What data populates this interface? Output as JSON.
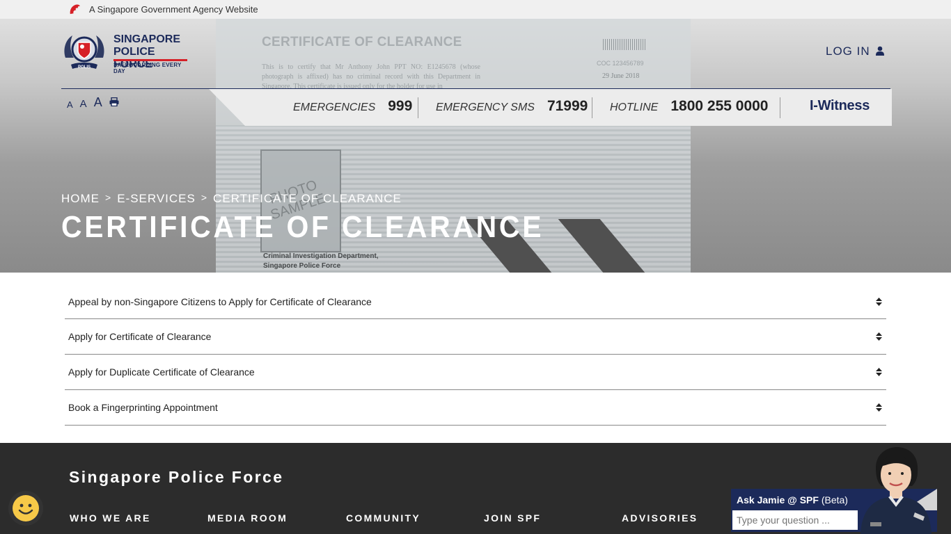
{
  "gov_bar": {
    "text": "A Singapore Government Agency Website"
  },
  "logo": {
    "title_line1": "SINGAPORE",
    "title_line2": "POLICE FORCE",
    "tagline": "SAFEGUARDING EVERY DAY",
    "badge_text": "POLIS"
  },
  "header": {
    "login_label": "LOG IN"
  },
  "hotlines": [
    {
      "label": "EMERGENCIES",
      "number": "999"
    },
    {
      "label": "EMERGENCY SMS",
      "number": "71999"
    },
    {
      "label": "HOTLINE",
      "number": "1800 255 0000"
    }
  ],
  "iwitness_label": "I-Witness",
  "font_tools": {
    "small": "A",
    "medium": "A",
    "large": "A"
  },
  "banner_image": {
    "heading": "CERTIFICATE OF CLEARANCE",
    "text": "This is to certify that Mr Anthony John PPT NO: E1245678 (whose photograph is affixed) has no criminal record with this Department in Singapore. This certificate is issued only for the holder for use in",
    "ref": "COC 123456789",
    "date": "29 June 2018",
    "photo_text_1": "PHOTO",
    "photo_text_2": "SAMPLE",
    "dept_line1": "Criminal Investigation Department,",
    "dept_line2": "Singapore Police Force"
  },
  "breadcrumb": {
    "home": "HOME",
    "sep1": ">",
    "eservices": "E-SERVICES",
    "sep2": ">",
    "current": "CERTIFICATE OF CLEARANCE"
  },
  "page_title": "CERTIFICATE OF CLEARANCE",
  "accordion": [
    {
      "label": "Appeal by non-Singapore Citizens to Apply for Certificate of Clearance"
    },
    {
      "label": "Apply for Certificate of Clearance"
    },
    {
      "label": "Apply for Duplicate Certificate of Clearance"
    },
    {
      "label": "Book a Fingerprinting Appointment"
    }
  ],
  "footer": {
    "title": "Singapore Police Force",
    "nav": [
      "WHO WE ARE",
      "MEDIA ROOM",
      "COMMUNITY",
      "JOIN SPF",
      "ADVISORIES"
    ]
  },
  "chat": {
    "title": "Ask Jamie @ SPF",
    "beta": "(Beta)",
    "placeholder": "Type your question ..."
  },
  "colors": {
    "navy": "#1c2a5a",
    "red": "#d62027",
    "footer_bg": "#2c2c2c"
  }
}
